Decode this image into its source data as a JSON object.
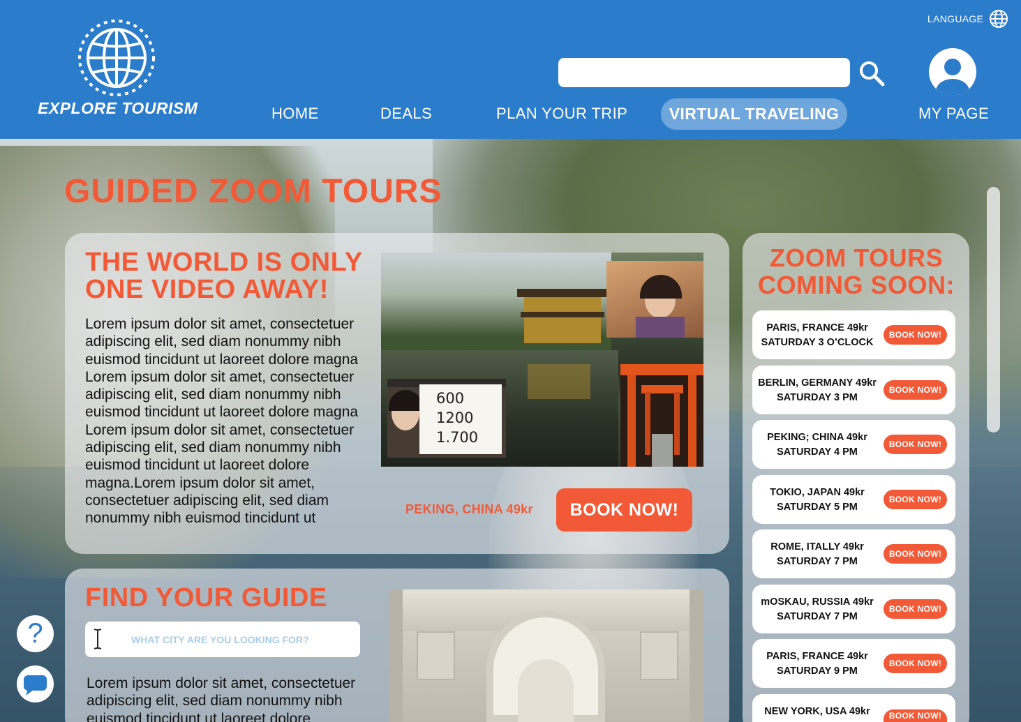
{
  "header": {
    "brand": "EXPLORE TOURISM",
    "language_label": "LANGUAGE",
    "search": {
      "value": "",
      "placeholder": ""
    },
    "nav": {
      "home": "HOME",
      "deals": "DEALS",
      "plan": "PLAN YOUR TRIP",
      "virtual": "VIRTUAL TRAVELING",
      "mypage": "MY PAGE"
    }
  },
  "main": {
    "page_title": "GUIDED ZOOM TOURS",
    "featured": {
      "heading_line1": "THE WORLD IS ONLY",
      "heading_line2": "ONE VIDEO AWAY!",
      "body": "Lorem ipsum dolor sit amet, consectetuer adipiscing elit, sed diam nonummy nibh euismod tincidunt ut laoreet dolore magna Lorem ipsum dolor sit amet, consectetuer adipiscing elit, sed diam nonummy nibh euismod tincidunt ut laoreet dolore magna Lorem ipsum dolor sit amet, consectetuer adipiscing elit, sed diam nonummy nibh euismod tincidunt ut laoreet dolore magna.Lorem ipsum dolor sit amet, consectetuer adipiscing elit, sed diam nonummy nibh euismod tincidunt ut",
      "tour_label": "PEKING, CHINA 49kr",
      "book_label": "BOOK NOW!",
      "whiteboard": {
        "line1": "600",
        "line2": "1200",
        "line3": "1.700"
      }
    },
    "guide": {
      "heading": "FIND YOUR GUIDE",
      "search_placeholder": "WHAT CITY ARE YOU LOOKING FOR?",
      "body": "Lorem ipsum dolor sit amet, consectetuer adipiscing elit, sed diam nonummy nibh euismod tincidunt ut laoreet dolore"
    }
  },
  "sidebar": {
    "title_line1": "ZOOM TOURS",
    "title_line2": "COMING SOON:",
    "tours": [
      {
        "line1": "PARIS, FRANCE 49kr",
        "line2": "SATURDAY 3 O’CLOCK",
        "button": "BOOK NOW!"
      },
      {
        "line1": "BERLIN, GERMANY 49kr",
        "line2": "SATURDAY 3 PM",
        "button": "BOOK NOW!"
      },
      {
        "line1": "PEKING; CHINA 49kr",
        "line2": "SATURDAY 4 PM",
        "button": "BOOK NOW!"
      },
      {
        "line1": "TOKIO, JAPAN 49kr",
        "line2": "SATURDAY 5 PM",
        "button": "BOOK NOW!"
      },
      {
        "line1": "ROME, ITALLY 49kr",
        "line2": "SATURDAY 7 PM",
        "button": "BOOK NOW!"
      },
      {
        "line1": "mOSKAU, RUSSIA 49kr",
        "line2": "SATURDAY 7 PM",
        "button": "BOOK NOW!"
      },
      {
        "line1": "PARIS, FRANCE 49kr",
        "line2": "SATURDAY 9 PM",
        "button": "BOOK NOW!"
      },
      {
        "line1": "NEW YORK, USA 49kr",
        "line2": "",
        "button": "BOOK NOW!"
      }
    ]
  },
  "floating": {
    "help_label": "?"
  },
  "colors": {
    "header_blue": "#2b7ccb",
    "accent_orange": "#f25a37",
    "card": "#eceef0"
  },
  "icons": [
    "globe-logo-icon",
    "language-globe-icon",
    "search-icon",
    "user-avatar-icon",
    "help-icon",
    "chat-icon",
    "text-cursor-icon"
  ]
}
